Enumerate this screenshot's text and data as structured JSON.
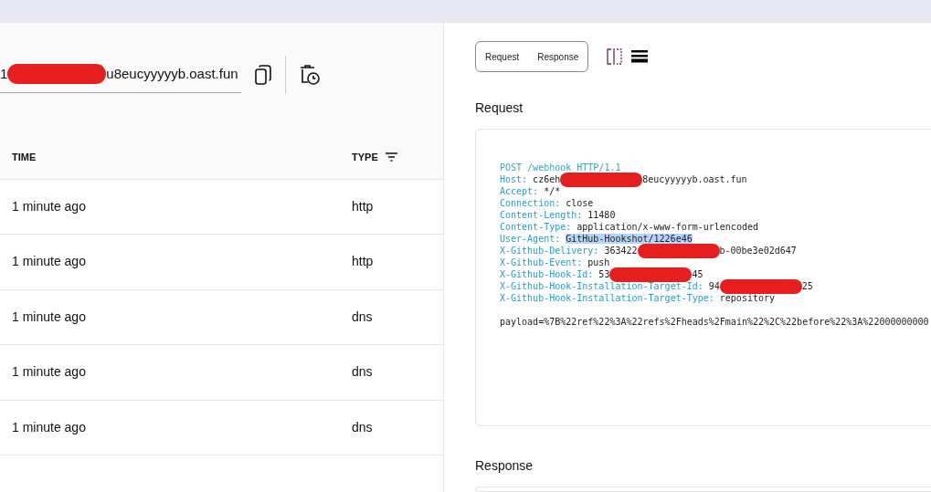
{
  "url_field": {
    "value": [
      {
        "kind": "text",
        "text": "1"
      },
      {
        "kind": "redaction"
      },
      {
        "kind": "text",
        "text": "u8eucyyyyyb.oast.fun"
      }
    ]
  },
  "table": {
    "columns": [
      {
        "label": "TIME"
      },
      {
        "label": "TYPE",
        "filter": true
      }
    ],
    "rows": [
      {
        "time": "1 minute ago",
        "type": "http"
      },
      {
        "time": "1 minute ago",
        "type": "http"
      },
      {
        "time": "1 minute ago",
        "type": "dns"
      },
      {
        "time": "1 minute ago",
        "type": "dns"
      },
      {
        "time": "1 minute ago",
        "type": "dns"
      }
    ]
  },
  "view_toggle": [
    {
      "label": "Request",
      "selected": false
    },
    {
      "label": "Response",
      "selected": false
    }
  ],
  "request": {
    "title": "Request",
    "request_line": "POST /webhook HTTP/1.1",
    "headers": [
      {
        "name": "Host:",
        "value": [
          {
            "kind": "text",
            "text": "cz6eh"
          },
          {
            "kind": "redaction"
          },
          {
            "kind": "text",
            "text": "8eucyyyyyb.oast.fun"
          }
        ]
      },
      {
        "name": "Accept:",
        "value": [
          {
            "kind": "text",
            "text": "*/*"
          }
        ]
      },
      {
        "name": "Connection:",
        "value": [
          {
            "kind": "text",
            "text": "close"
          }
        ]
      },
      {
        "name": "Content-Length:",
        "value": [
          {
            "kind": "text",
            "text": "11480"
          }
        ]
      },
      {
        "name": "Content-Type:",
        "value": [
          {
            "kind": "text",
            "text": "application/x-www-form-urlencoded"
          }
        ]
      },
      {
        "name": "User-Agent:",
        "value": [
          {
            "kind": "text",
            "text": "GitHub-Hookshot/1226e46",
            "highlighted": true
          }
        ]
      },
      {
        "name": "X-Github-Delivery:",
        "value": [
          {
            "kind": "text",
            "text": "363422"
          },
          {
            "kind": "redaction"
          },
          {
            "kind": "text",
            "text": "b-00be3e02d647"
          }
        ]
      },
      {
        "name": "X-Github-Event:",
        "value": [
          {
            "kind": "text",
            "text": "push"
          }
        ]
      },
      {
        "name": "X-Github-Hook-Id:",
        "value": [
          {
            "kind": "text",
            "text": "53"
          },
          {
            "kind": "redaction"
          },
          {
            "kind": "text",
            "text": "45"
          }
        ]
      },
      {
        "name": "X-Github-Hook-Installation-Target-Id:",
        "value": [
          {
            "kind": "text",
            "text": "94"
          },
          {
            "kind": "redaction"
          },
          {
            "kind": "text",
            "text": "25"
          }
        ]
      },
      {
        "name": "X-Github-Hook-Installation-Target-Type:",
        "value": [
          {
            "kind": "text",
            "text": "repository"
          }
        ]
      }
    ],
    "body": "payload=%7B%22ref%22%3A%22refs%2Fheads%2Fmain%22%2C%22before%22%3A%22000000000"
  },
  "response": {
    "title": "Response"
  }
}
